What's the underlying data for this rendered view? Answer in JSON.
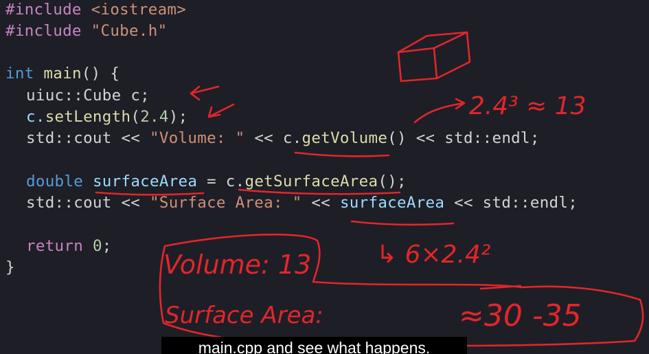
{
  "code": {
    "l1": {
      "kw": "#include",
      "path": "<iostream>"
    },
    "l2": {
      "kw": "#include",
      "path": "\"Cube.h\""
    },
    "l4": {
      "type": "int",
      "fn": "main",
      "rest": "() {"
    },
    "l5": {
      "ns": "uiuc::Cube",
      "rest": " c;"
    },
    "l6": {
      "obj": "c.",
      "fn": "setLength",
      "p1": "(",
      "num": "2.4",
      "p2": ");"
    },
    "l7": {
      "a": "std::cout << ",
      "str": "\"Volume: \"",
      "b": " << c.",
      "fn": "getVolume",
      "c": "() << std::endl;"
    },
    "l9": {
      "type": "double",
      "var": "surfaceArea",
      "b": " = c.",
      "fn": "getSurfaceArea",
      "c": "();"
    },
    "l10": {
      "a": "std::cout << ",
      "str": "\"Surface Area: \"",
      "b": " << ",
      "var": "surfaceArea",
      "c": " << std::endl;"
    },
    "l12": {
      "kw": "return",
      "num": "0",
      "rest": ";"
    },
    "l13": {
      "text": "}"
    }
  },
  "annotations": {
    "volume_calc": "2.4³ ≈ 13",
    "surface_calc": "↳ 6×2.4²",
    "output_volume": "Volume: 13",
    "output_surface": "Surface Area:",
    "surface_estimate": "≈30 -35"
  },
  "subtitle": "main.cpp and see what happens."
}
